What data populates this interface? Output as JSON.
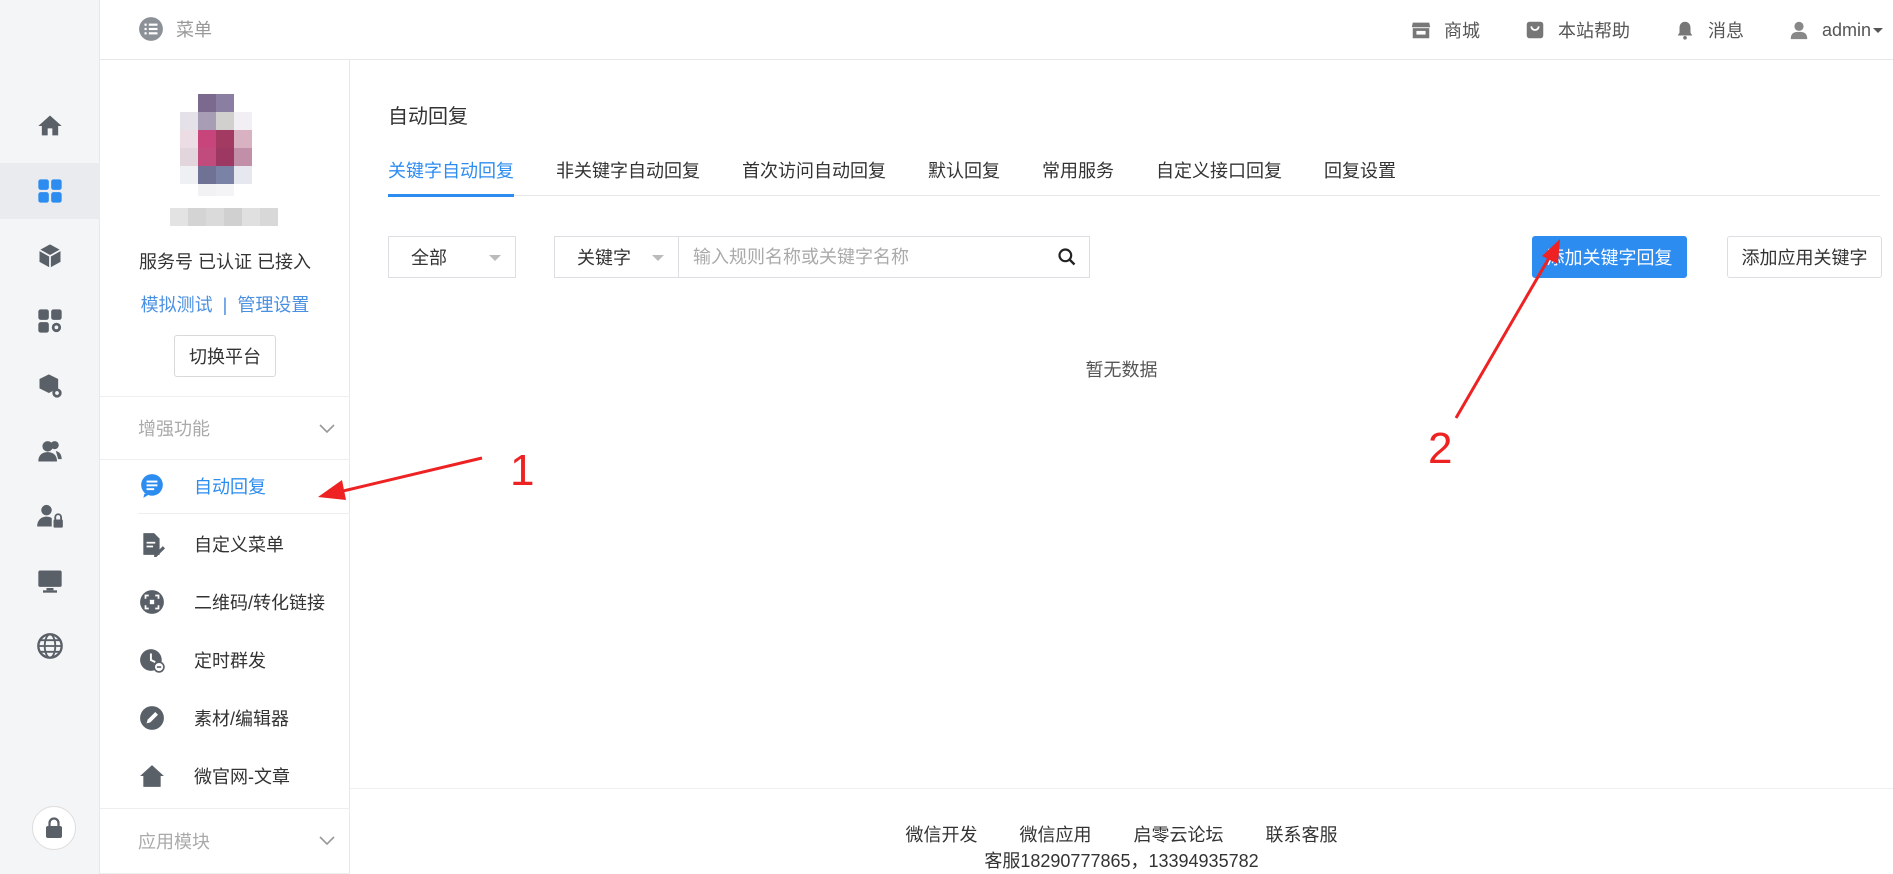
{
  "topbar": {
    "menu_label": "菜单",
    "links": [
      {
        "label": "商城",
        "icon": "store-icon"
      },
      {
        "label": "本站帮助",
        "icon": "help-bag-icon"
      },
      {
        "label": "消息",
        "icon": "bell-icon"
      }
    ],
    "user": "admin"
  },
  "rail": {
    "icons": [
      "home-icon",
      "grid-apps-icon",
      "cube-icon",
      "apps-settings-icon",
      "package-settings-icon",
      "users-icon",
      "user-lock-icon",
      "monitor-icon",
      "globe-icon",
      "lock-icon"
    ],
    "active_index": 1
  },
  "account": {
    "status": "服务号 已认证 已接入",
    "link_test": "模拟测试",
    "link_sep": "|",
    "link_manage": "管理设置",
    "switch_label": "切换平台"
  },
  "side": {
    "group1": "增强功能",
    "items": [
      {
        "label": "自动回复",
        "icon": "chat-bubble-icon",
        "active": true
      },
      {
        "label": "自定义菜单",
        "icon": "document-edit-icon"
      },
      {
        "label": "二维码/转化链接",
        "icon": "qrcode-scan-icon"
      },
      {
        "label": "定时群发",
        "icon": "clock-send-icon"
      },
      {
        "label": "素材/编辑器",
        "icon": "pencil-circle-icon"
      },
      {
        "label": "微官网-文章",
        "icon": "house-icon"
      }
    ],
    "group2": "应用模块"
  },
  "main": {
    "title": "自动回复",
    "tabs": [
      "关键字自动回复",
      "非关键字自动回复",
      "首次访问自动回复",
      "默认回复",
      "常用服务",
      "自定义接口回复",
      "回复设置"
    ],
    "active_tab": 0,
    "filter_all": "全部",
    "keyword_select": "关键字",
    "search_placeholder": "输入规则名称或关键字名称",
    "btn_add_keyword": "添加关键字回复",
    "btn_add_app_keyword": "添加应用关键字",
    "empty": "暂无数据"
  },
  "footer": {
    "links": [
      "微信开发",
      "微信应用",
      "启零云论坛",
      "联系客服"
    ],
    "contact": "客服18290777865，13394935782"
  },
  "annotations": {
    "n1": "1",
    "n2": "2",
    "color": "#ee2222"
  },
  "colors": {
    "accent": "#2d8cf0"
  }
}
